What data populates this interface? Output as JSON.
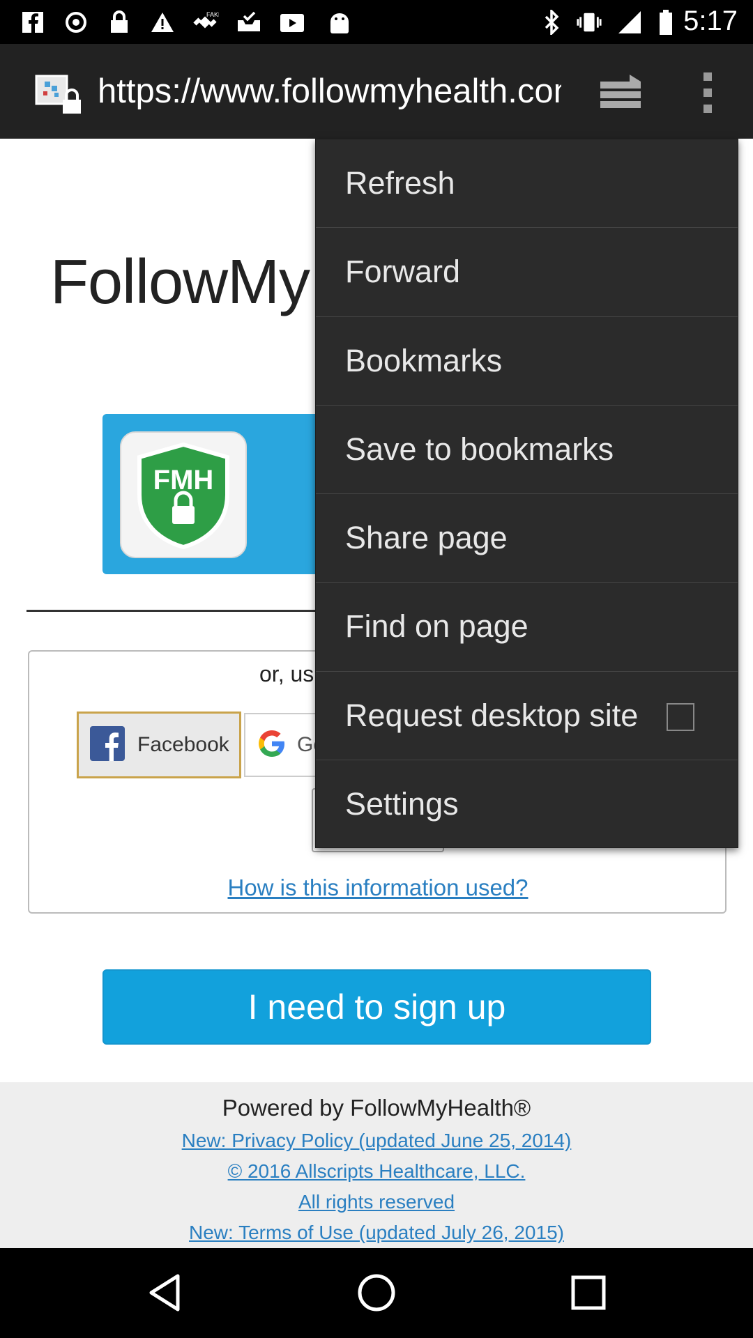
{
  "status_bar": {
    "time": "5:17",
    "left_icons": [
      "facebook-icon",
      "sync-icon",
      "lock-icon",
      "warning-icon",
      "fake-gps-icon",
      "inbox-check-icon",
      "youtube-icon",
      "android-icon"
    ],
    "right_icons": [
      "bluetooth-icon",
      "vibrate-icon",
      "signal-icon",
      "battery-icon"
    ]
  },
  "browser": {
    "url": "https://www.followmyhealth.com"
  },
  "page": {
    "logo_text": "FollowMy",
    "fmh_badge": "FMH",
    "social_prompt": "or, us",
    "facebook_label": "Facebook",
    "google_label": "Go",
    "info_link": "How is this information used?",
    "signup_label": "I need to sign up",
    "footer": {
      "powered_by": "Powered by FollowMyHealth®",
      "links": [
        "New: Privacy Policy (updated June 25, 2014)",
        "© 2016 Allscripts Healthcare, LLC.",
        "All rights reserved",
        "New: Terms of Use (updated July 26, 2015)"
      ]
    }
  },
  "menu": {
    "items": [
      "Refresh",
      "Forward",
      "Bookmarks",
      "Save to bookmarks",
      "Share page",
      "Find on page",
      "Request desktop site",
      "Settings"
    ],
    "request_desktop_checked": false
  },
  "colors": {
    "toolbar": "#222222",
    "menu": "#2b2b2b",
    "accent_blue": "#12a1dc",
    "link": "#2a7fc1",
    "shield_green": "#2e9e46"
  }
}
